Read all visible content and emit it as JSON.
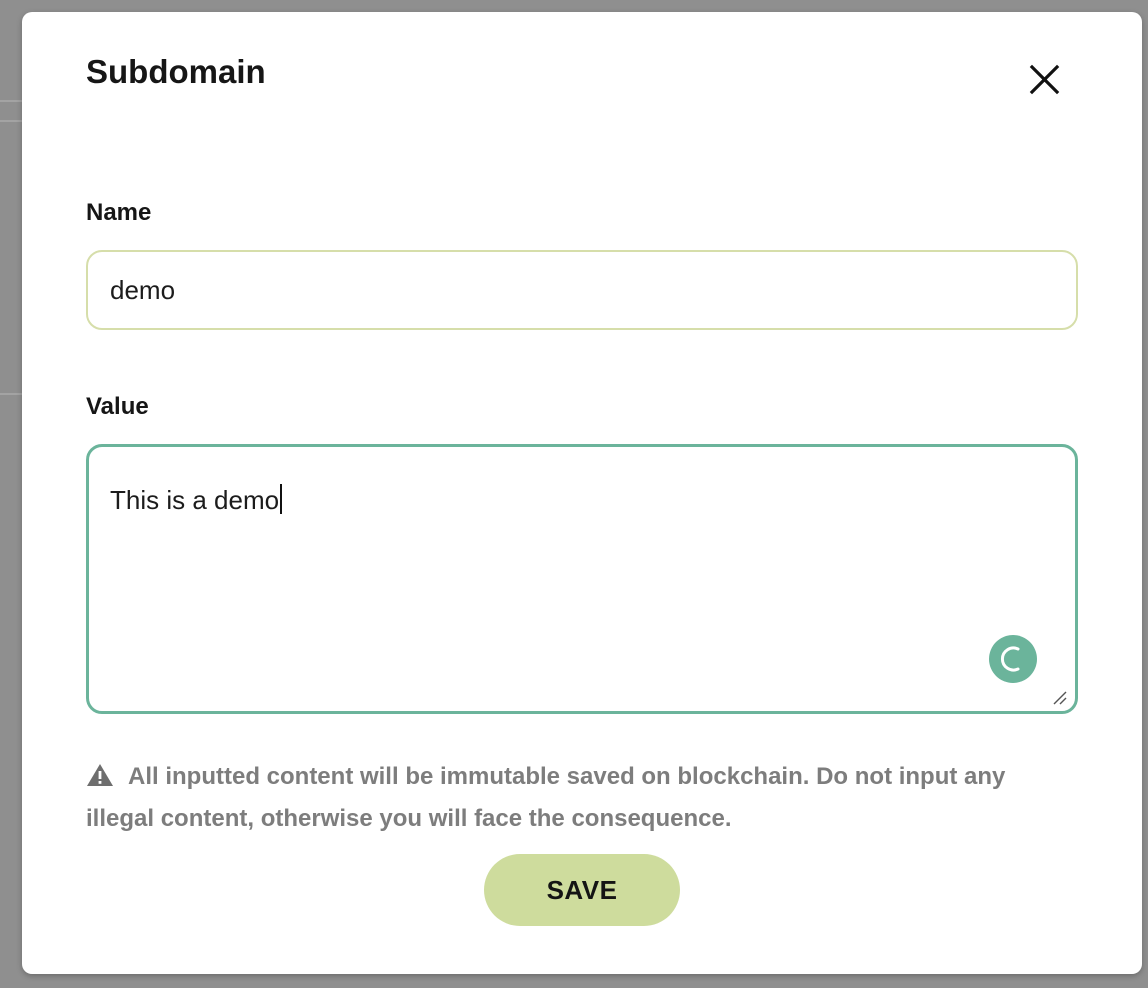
{
  "dialog": {
    "title": "Subdomain",
    "close_icon": "close-icon"
  },
  "form": {
    "name_label": "Name",
    "name_value": "demo",
    "value_label": "Value",
    "value_text": "This is a demo",
    "assistant_icon": "grammar-assistant-icon",
    "resize_icon": "resize-handle-icon"
  },
  "notice": {
    "icon": "warning-icon",
    "text": "All inputted content will be immutable saved on blockchain. Do not input any illegal content, otherwise you will face the consequence."
  },
  "actions": {
    "save_label": "SAVE"
  },
  "colors": {
    "overlay": "#8f8f8f",
    "name_border": "#d6deaa",
    "value_border": "#6bb49b",
    "save_button": "#cedc9d",
    "notice_text": "#7d7d7d"
  }
}
